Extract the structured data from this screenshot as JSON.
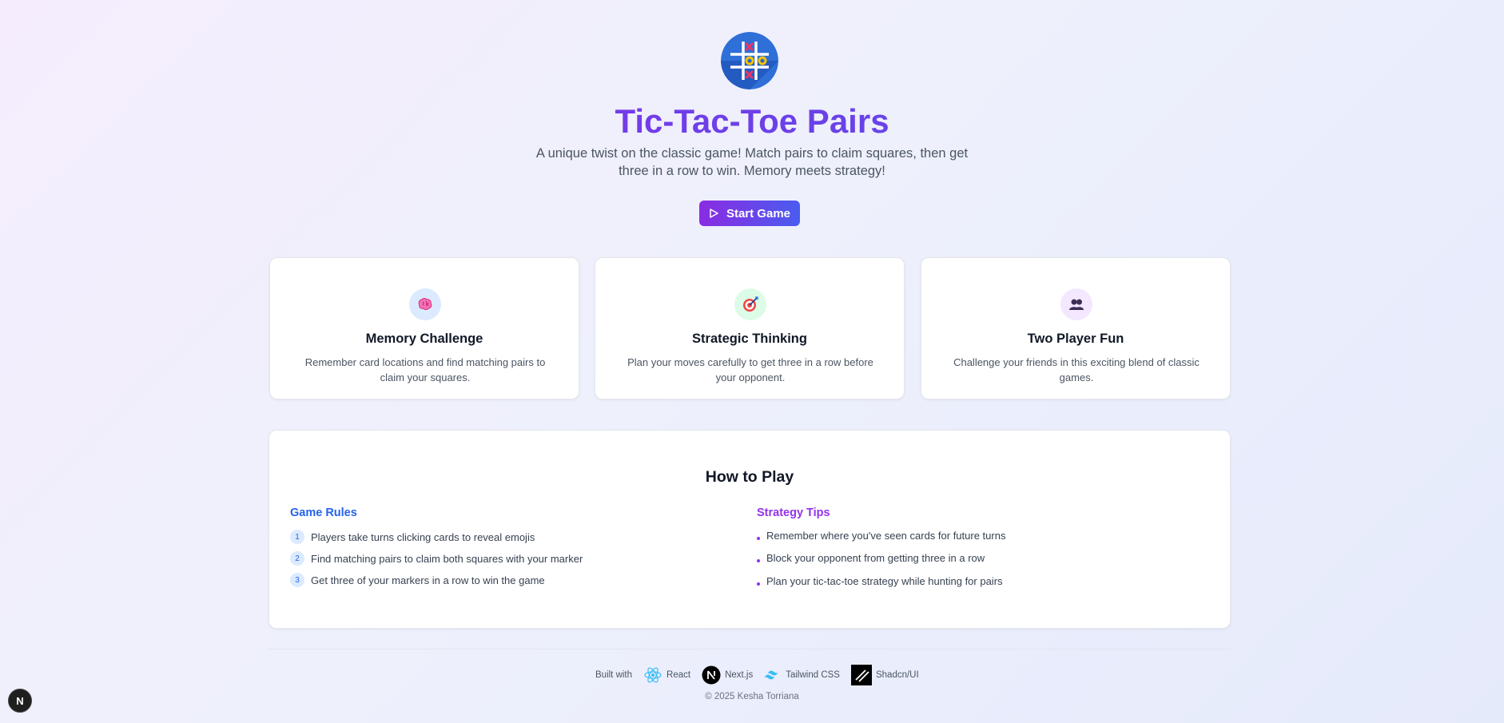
{
  "hero": {
    "title": "Tic-Tac-Toe Pairs",
    "subtitle": "A unique twist on the classic game! Match pairs to claim squares, then get three in a row to win. Memory meets strategy!",
    "start_button": "Start Game",
    "logo_icon": "tic-tac-toe-logo-icon"
  },
  "features": [
    {
      "icon": "brain-icon",
      "title": "Memory Challenge",
      "description": "Remember card locations and find matching pairs to claim your squares."
    },
    {
      "icon": "target-icon",
      "title": "Strategic Thinking",
      "description": "Plan your moves carefully to get three in a row before your opponent."
    },
    {
      "icon": "people-icon",
      "title": "Two Player Fun",
      "description": "Challenge your friends in this exciting blend of classic games."
    }
  ],
  "how_to_play": {
    "title": "How to Play",
    "rules": {
      "heading": "Game Rules",
      "items": [
        {
          "num": "1",
          "text": "Players take turns clicking cards to reveal emojis"
        },
        {
          "num": "2",
          "text": "Find matching pairs to claim both squares with your marker"
        },
        {
          "num": "3",
          "text": "Get three of your markers in a row to win the game"
        }
      ]
    },
    "tips": {
      "heading": "Strategy Tips",
      "items": [
        "Remember where you've seen cards for future turns",
        "Block your opponent from getting three in a row",
        "Plan your tic-tac-toe strategy while hunting for pairs"
      ]
    }
  },
  "footer": {
    "built_with": "Built with",
    "tech": [
      {
        "icon": "react-icon",
        "label": "React"
      },
      {
        "icon": "nextjs-icon",
        "label": "Next.js"
      },
      {
        "icon": "tailwind-icon",
        "label": "Tailwind CSS"
      },
      {
        "icon": "shadcn-icon",
        "label": "Shadcn/UI"
      }
    ],
    "copyright": "© 2025 Kesha Torriana"
  },
  "dev_badge": "N",
  "colors": {
    "accent_purple": "#8b2fe6",
    "accent_blue": "#4f56ea",
    "rules_heading": "#2563eb",
    "tips_heading": "#9333ea"
  }
}
